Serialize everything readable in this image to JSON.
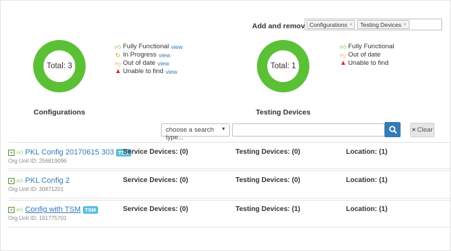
{
  "charts_picker": {
    "label": "Add and remove charts:",
    "chips": [
      {
        "label": "Configurations",
        "remove": "×"
      },
      {
        "label": "Testing Devices",
        "remove": "×"
      }
    ]
  },
  "colors": {
    "fully_functional": "#5bc036",
    "in_progress": "#e0a800",
    "out_of_date": "#f0932b",
    "unable_to_find": "#d9302c",
    "link": "#337ab7",
    "tsm_badge": "#5bc0de"
  },
  "chart_data": [
    {
      "type": "pie",
      "title": "Configurations",
      "center_label": "Total: 3",
      "slices": [
        {
          "name": "Fully Functional",
          "value": 3
        }
      ],
      "legend": [
        {
          "icon": "thumbs-up-icon",
          "label": "Fully Functional",
          "link": "view"
        },
        {
          "icon": "in-progress-icon",
          "label": "In Progress",
          "link": "view"
        },
        {
          "icon": "thumbs-down-icon",
          "label": "Out of date",
          "link": "view"
        },
        {
          "icon": "warning-icon",
          "label": "Unable to find",
          "link": "view"
        }
      ]
    },
    {
      "type": "pie",
      "title": "Testing Devices",
      "center_label": "Total: 1",
      "slices": [
        {
          "name": "Fully Functional",
          "value": 1
        }
      ],
      "legend": [
        {
          "icon": "thumbs-up-icon",
          "label": "Fully Functional"
        },
        {
          "icon": "thumbs-down-icon",
          "label": "Out of date"
        },
        {
          "icon": "warning-icon",
          "label": "Unable to find"
        }
      ]
    }
  ],
  "search": {
    "type_placeholder": "choose a search type...",
    "query_value": "",
    "search_icon": "search-icon",
    "clear_label": "Clear",
    "clear_icon": "×"
  },
  "rows": [
    {
      "name": "PKL Config 20170615 303",
      "tsm": "TSM",
      "org": "Org Unit ID: 256819096",
      "service": "Service Devices: (0)",
      "testing": "Testing Devices: (0)",
      "location": "Location: (1)"
    },
    {
      "name": "PKL Config 2",
      "tsm": "",
      "org": "Org Unit ID: 30871201",
      "service": "Service Devices: (0)",
      "testing": "Testing Devices: (0)",
      "location": "Location: (1)"
    },
    {
      "name": "Config with TSM",
      "tsm": "TSM",
      "org": "Org Unit ID: 161775701",
      "service": "Service Devices: (0)",
      "testing": "Testing Devices: (1)",
      "location": "Location: (1)"
    }
  ]
}
